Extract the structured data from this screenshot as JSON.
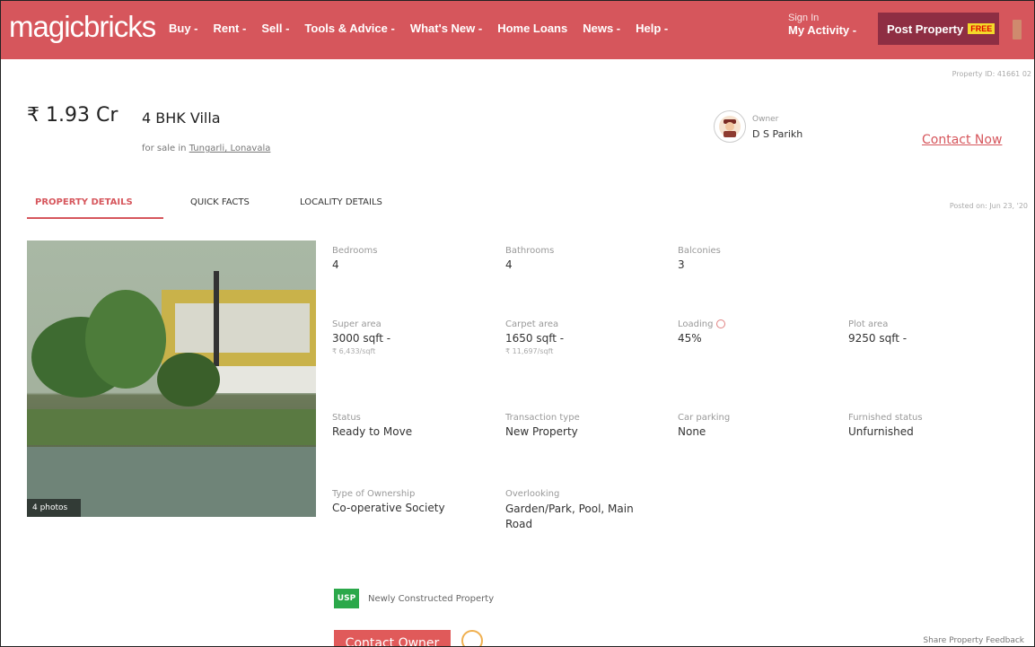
{
  "header": {
    "logo": "magicbricks",
    "nav": [
      "Buy -",
      "Rent -",
      "Sell -",
      "Tools & Advice -",
      "What's New -",
      "Home Loans",
      "News -",
      "Help -"
    ],
    "signin_top": "Sign In",
    "signin_bottom": "My Activity -",
    "post_property": "Post Property",
    "free_badge": "FREE"
  },
  "listing": {
    "property_id": "Property ID: 41661 02",
    "price": "₹ 1.93 Cr",
    "title": "4 BHK Villa",
    "subtitle_prefix": "for sale in",
    "location": "Tungarli, Lonavala",
    "owner_label": "Owner",
    "owner_name": "D S Parikh",
    "contact_now": "Contact Now",
    "posted_on": "Posted on: Jun 23, '20"
  },
  "tabs": [
    "PROPERTY DETAILS",
    "QUICK FACTS",
    "LOCALITY DETAILS"
  ],
  "photo": {
    "count_label": "4 photos"
  },
  "facts": {
    "bedrooms": {
      "label": "Bedrooms",
      "value": "4"
    },
    "bathrooms": {
      "label": "Bathrooms",
      "value": "4"
    },
    "balconies": {
      "label": "Balconies",
      "value": "3"
    },
    "super_area": {
      "label": "Super area",
      "value": "3000 sqft -",
      "sub": "₹ 6,433/sqft"
    },
    "carpet_area": {
      "label": "Carpet area",
      "value": "1650 sqft -",
      "sub": "₹ 11,697/sqft"
    },
    "loading": {
      "label": "Loading",
      "value": "45%"
    },
    "plot_area": {
      "label": "Plot area",
      "value": "9250 sqft -"
    },
    "status": {
      "label": "Status",
      "value": "Ready to Move"
    },
    "transaction": {
      "label": "Transaction type",
      "value": "New Property"
    },
    "car_parking": {
      "label": "Car parking",
      "value": "None"
    },
    "furnished": {
      "label": "Furnished status",
      "value": "Unfurnished"
    },
    "ownership": {
      "label": "Type of Ownership",
      "value": "Co-operative Society"
    },
    "overlooking": {
      "label": "Overlooking",
      "value": "Garden/Park, Pool, Main Road"
    }
  },
  "usp": {
    "badge": "USP",
    "text": "Newly Constructed Property"
  },
  "actions": {
    "contact_owner": "Contact Owner",
    "share_feedback": "Share Property Feedback"
  },
  "colors": {
    "brand": "#d6565c",
    "post_button": "#8e2e43",
    "usp": "#2ba84a"
  }
}
